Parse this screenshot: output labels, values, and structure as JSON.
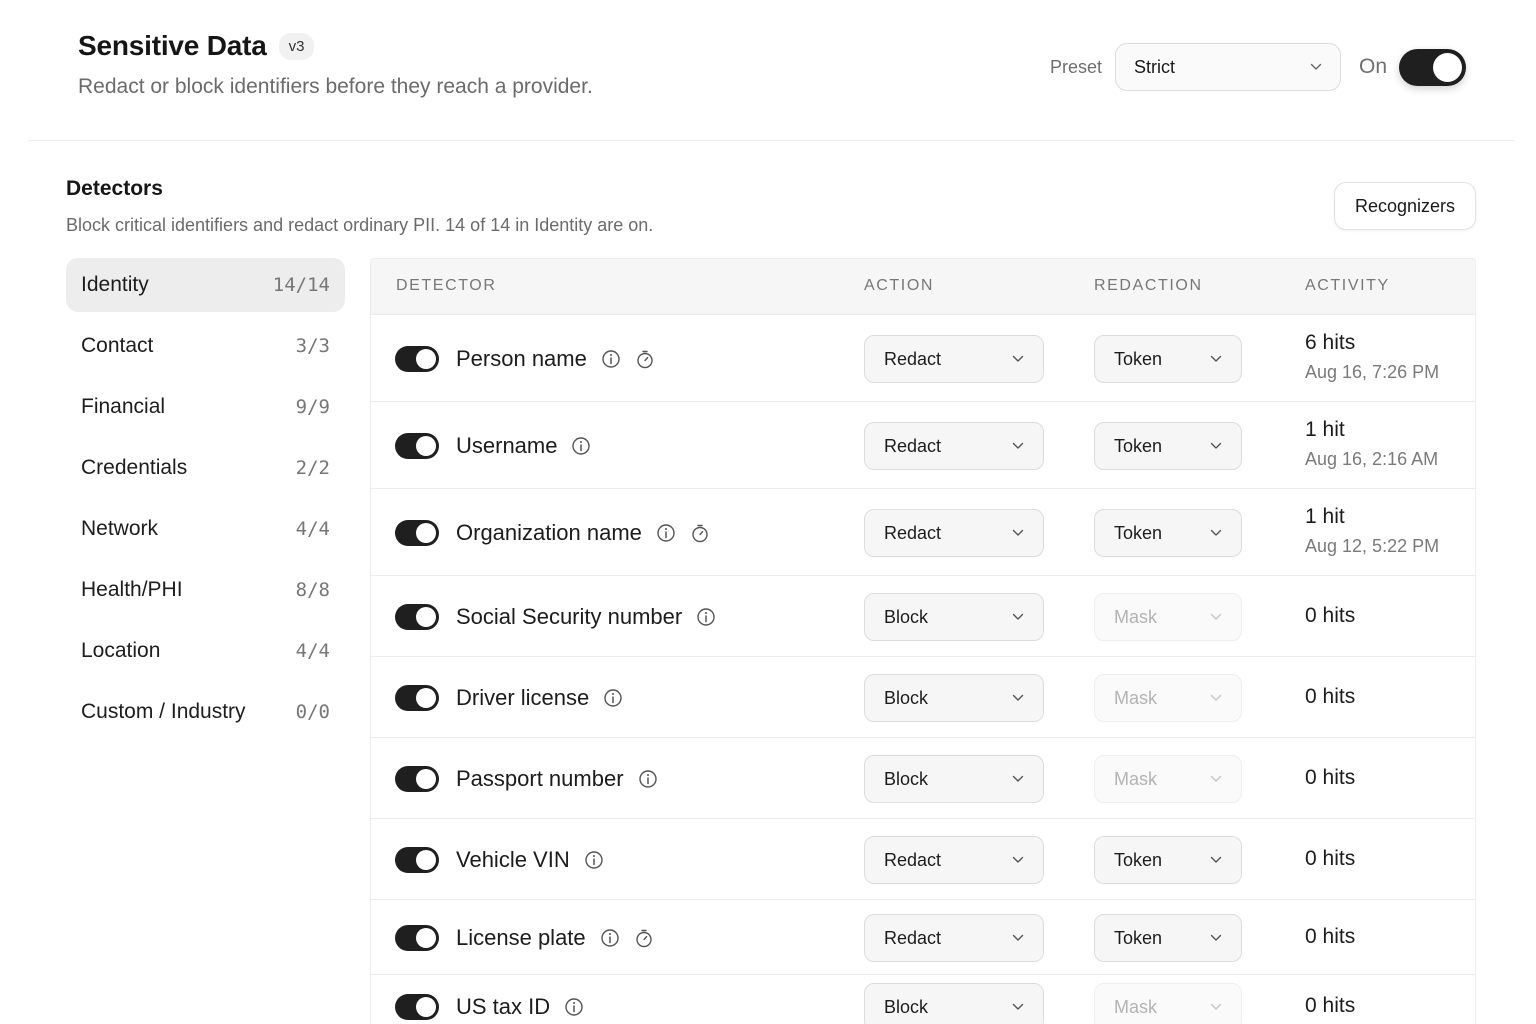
{
  "header": {
    "title": "Sensitive Data",
    "version": "v3",
    "subtitle": "Redact or block identifiers before they reach a provider.",
    "preset_label": "Preset",
    "preset_value": "Strict",
    "enabled_label": "On",
    "enabled": true
  },
  "section": {
    "title": "Detectors",
    "description": "Block critical identifiers and redact ordinary PII. 14 of 14 in Identity are on.",
    "recognizers_label": "Recognizers"
  },
  "categories": [
    {
      "name": "Identity",
      "count": "14/14",
      "active": true
    },
    {
      "name": "Contact",
      "count": "3/3"
    },
    {
      "name": "Financial",
      "count": "9/9"
    },
    {
      "name": "Credentials",
      "count": "2/2"
    },
    {
      "name": "Network",
      "count": "4/4"
    },
    {
      "name": "Health/PHI",
      "count": "8/8"
    },
    {
      "name": "Location",
      "count": "4/4"
    },
    {
      "name": "Custom / Industry",
      "count": "0/0"
    }
  ],
  "table": {
    "columns": [
      "DETECTOR",
      "ACTION",
      "REDACTION",
      "ACTIVITY"
    ],
    "rows": [
      {
        "name": "Person name",
        "enabled": true,
        "info": true,
        "timer": true,
        "action": "Redact",
        "redaction": "Token",
        "redaction_disabled": false,
        "hits": "6 hits",
        "last": "Aug 16, 7:26 PM"
      },
      {
        "name": "Username",
        "enabled": true,
        "info": true,
        "timer": false,
        "action": "Redact",
        "redaction": "Token",
        "redaction_disabled": false,
        "hits": "1 hit",
        "last": "Aug 16, 2:16 AM"
      },
      {
        "name": "Organization name",
        "enabled": true,
        "info": true,
        "timer": true,
        "action": "Redact",
        "redaction": "Token",
        "redaction_disabled": false,
        "hits": "1 hit",
        "last": "Aug 12, 5:22 PM"
      },
      {
        "name": "Social Security number",
        "enabled": true,
        "info": true,
        "timer": false,
        "action": "Block",
        "redaction": "Mask",
        "redaction_disabled": true,
        "hits": "0 hits",
        "last": ""
      },
      {
        "name": "Driver license",
        "enabled": true,
        "info": true,
        "timer": false,
        "action": "Block",
        "redaction": "Mask",
        "redaction_disabled": true,
        "hits": "0 hits",
        "last": ""
      },
      {
        "name": "Passport number",
        "enabled": true,
        "info": true,
        "timer": false,
        "action": "Block",
        "redaction": "Mask",
        "redaction_disabled": true,
        "hits": "0 hits",
        "last": ""
      },
      {
        "name": "Vehicle VIN",
        "enabled": true,
        "info": true,
        "timer": false,
        "action": "Redact",
        "redaction": "Token",
        "redaction_disabled": false,
        "hits": "0 hits",
        "last": ""
      },
      {
        "name": "License plate",
        "enabled": true,
        "info": true,
        "timer": true,
        "action": "Redact",
        "redaction": "Token",
        "redaction_disabled": false,
        "hits": "0 hits",
        "last": ""
      },
      {
        "name": "US tax ID",
        "enabled": true,
        "info": true,
        "timer": false,
        "action": "Block",
        "redaction": "Mask",
        "redaction_disabled": true,
        "hits": "0 hits",
        "last": ""
      }
    ]
  },
  "icons": {
    "info": "info-icon",
    "timer": "timer-icon",
    "chevron": "chevron-down-icon"
  }
}
